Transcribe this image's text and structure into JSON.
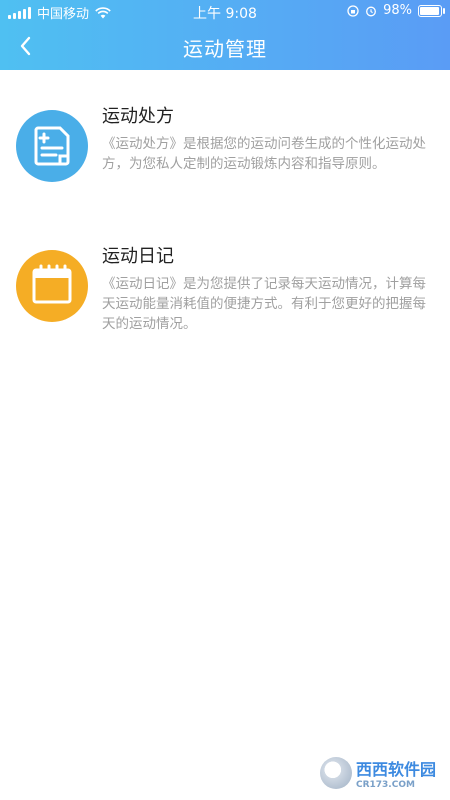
{
  "status_bar": {
    "carrier": "中国移动",
    "time": "上午 9:08",
    "battery_percent": "98%",
    "battery_level": 0.98
  },
  "header": {
    "title": "运动管理",
    "gradient_start": "#4fc0f2",
    "gradient_end": "#5a9cf5"
  },
  "items": [
    {
      "title": "运动处方",
      "description": "《运动处方》是根据您的运动问卷生成的个性化运动处方，为您私人定制的运动锻炼内容和指导原则。",
      "icon": "prescription-document-icon",
      "color": "#4aaee8"
    },
    {
      "title": "运动日记",
      "description": "《运动日记》是为您提供了记录每天运动情况，计算每天运动能量消耗值的便捷方式。有利于您更好的把握每天的运动情况。",
      "icon": "calendar-icon",
      "color": "#f5ad25"
    }
  ],
  "watermark": {
    "brand": "西西软件园",
    "site": "CR173.COM"
  }
}
